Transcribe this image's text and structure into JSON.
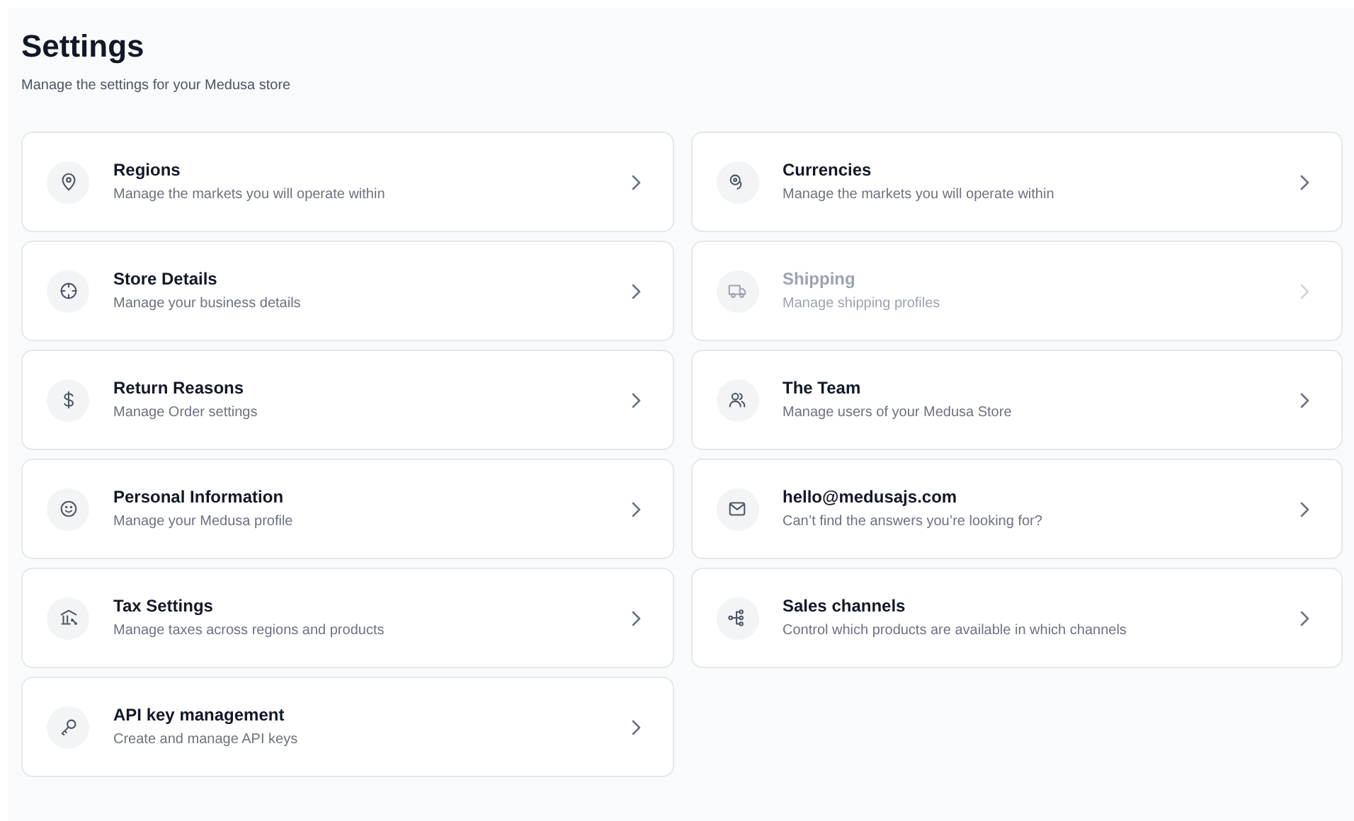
{
  "header": {
    "title": "Settings",
    "subtitle": "Manage the settings for your Medusa store"
  },
  "left_column": [
    {
      "title": "Regions",
      "description": "Manage the markets you will operate within",
      "disabled": false
    },
    {
      "title": "Store Details",
      "description": "Manage your business details",
      "disabled": false
    },
    {
      "title": "Return Reasons",
      "description": "Manage Order settings",
      "disabled": false
    },
    {
      "title": "Personal Information",
      "description": "Manage your Medusa profile",
      "disabled": false
    },
    {
      "title": "Tax Settings",
      "description": "Manage taxes across regions and products",
      "disabled": false
    },
    {
      "title": "API key management",
      "description": "Create and manage API keys",
      "disabled": false
    }
  ],
  "right_column": [
    {
      "title": "Currencies",
      "description": "Manage the markets you will operate within",
      "disabled": false
    },
    {
      "title": "Shipping",
      "description": "Manage shipping profiles",
      "disabled": true
    },
    {
      "title": "The Team",
      "description": "Manage users of your Medusa Store",
      "disabled": false
    },
    {
      "title": "hello@medusajs.com",
      "description": "Can’t find the answers you’re looking for?",
      "disabled": false
    },
    {
      "title": "Sales channels",
      "description": "Control which products are available in which channels",
      "disabled": false
    }
  ]
}
